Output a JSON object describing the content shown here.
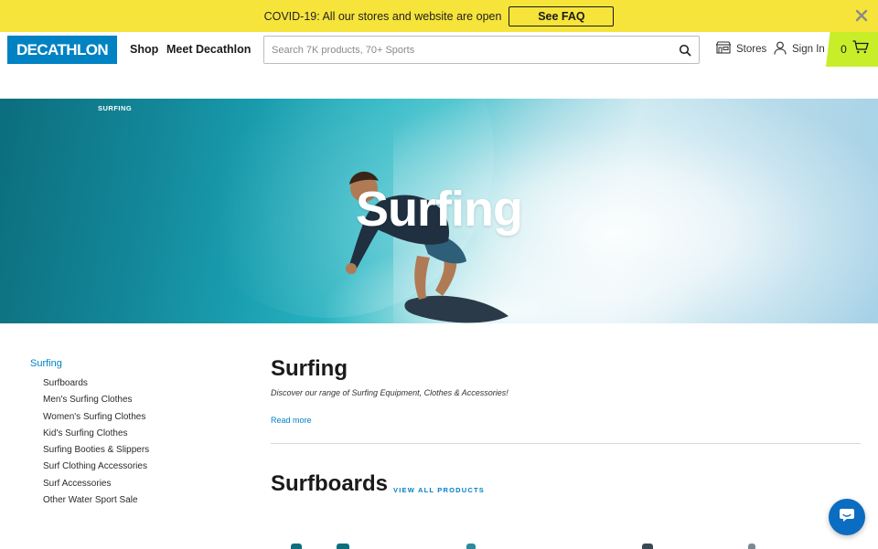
{
  "announcement": {
    "text": "COVID-19: All our stores and website are open",
    "button_label": "See FAQ",
    "close_icon": "close-icon"
  },
  "header": {
    "logo_text": "DECATHLON",
    "nav": [
      "Shop",
      "Meet Decathlon"
    ],
    "search_placeholder": "Search 7K products, 70+ Sports",
    "stores_label": "Stores",
    "signin_label": "Sign In",
    "cart_count": "0",
    "colors": {
      "brand": "#0082c3",
      "cart": "#c8ee2a",
      "banner": "#f6e43a"
    }
  },
  "hero": {
    "breadcrumb": "SURFING",
    "title": "Surfing"
  },
  "sidebar": {
    "title": "Surfing",
    "items": [
      "Surfboards",
      "Men's Surfing Clothes",
      "Women's Surfing Clothes",
      "Kid's Surfing Clothes",
      "Surfing Booties & Slippers",
      "Surf Clothing Accessories",
      "Surf Accessories",
      "Other Water Sport Sale"
    ]
  },
  "main": {
    "title": "Surfing",
    "description": "Discover our range of Surfing Equipment, Clothes & Accessories!",
    "read_more": "Read more",
    "section_title": "Surfboards",
    "view_all": "VIEW ALL PRODUCTS"
  },
  "chat": {
    "icon": "chat-icon"
  }
}
